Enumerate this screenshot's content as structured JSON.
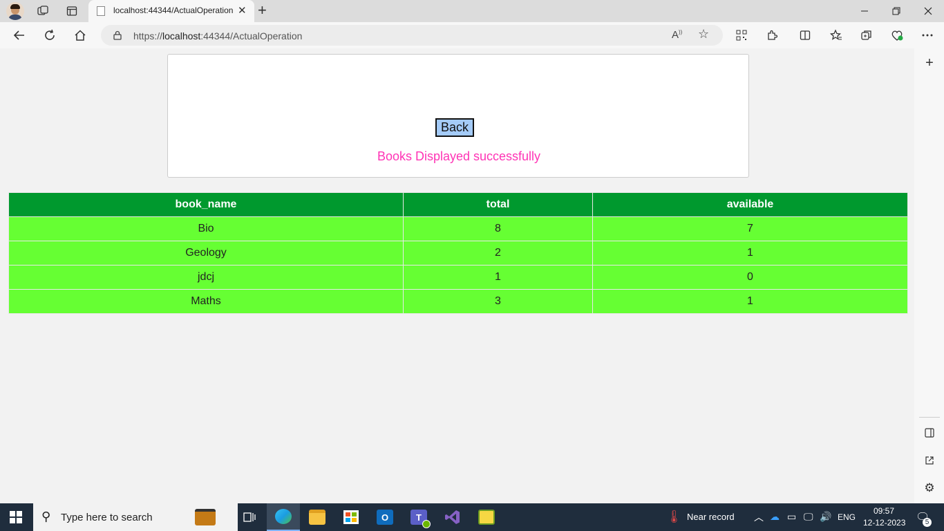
{
  "browser": {
    "tab_title": "localhost:44344/ActualOperation",
    "tab_close": "✕",
    "new_tab": "+",
    "url_prefix": "https://",
    "url_host": "localhost",
    "url_rest": ":44344/ActualOperation"
  },
  "page": {
    "back_button": "Back",
    "message": "Books Displayed successfully",
    "message_color": "#ff33b5",
    "table": {
      "headers": [
        "book_name",
        "total",
        "available"
      ],
      "rows": [
        [
          "Bio",
          "8",
          "7"
        ],
        [
          "Geology",
          "2",
          "1"
        ],
        [
          "jdcj",
          "1",
          "0"
        ],
        [
          "Maths",
          "3",
          "1"
        ]
      ],
      "header_color": "#00992e",
      "row_color": "#66ff33"
    }
  },
  "taskbar": {
    "search_placeholder": "Type here to search",
    "weather": "Near record",
    "language": "ENG",
    "time": "09:57",
    "date": "12-12-2023",
    "notification_count": "5"
  }
}
